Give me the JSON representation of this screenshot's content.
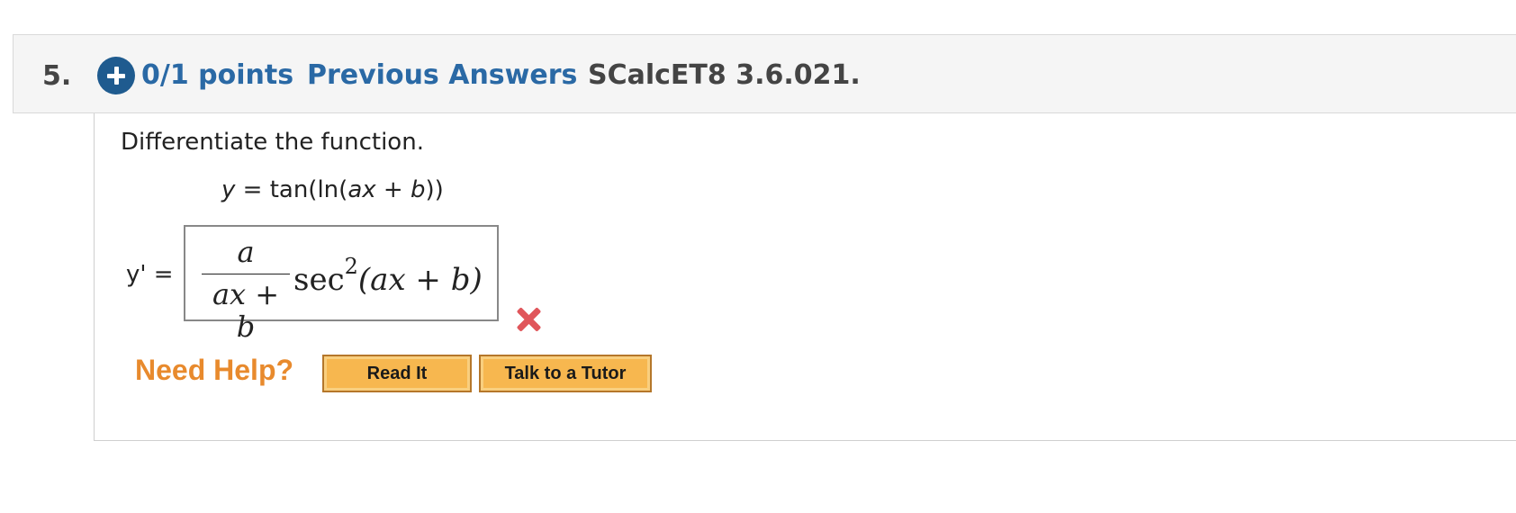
{
  "question": {
    "number": "5.",
    "points": "0/1 points",
    "previous_answers": "Previous Answers",
    "code": "SCalcET8 3.6.021."
  },
  "prompt": "Differentiate the function.",
  "function": {
    "lhs": "y",
    "eq": " = tan(ln(",
    "a": "ax",
    "plus": " + ",
    "b": "b",
    "close": "))"
  },
  "answer": {
    "label": "y' =",
    "numerator": "a",
    "denominator": "ax + b",
    "func": "sec",
    "exponent": "2",
    "argument": "(ax + b)",
    "status": "incorrect"
  },
  "help": {
    "label": "Need Help?",
    "read_it": "Read It",
    "tutor": "Talk to a Tutor"
  },
  "colors": {
    "link": "#2a69a5",
    "plus_icon": "#1f5b8f",
    "need_help": "#e88a2d",
    "button": "#f7b74f",
    "wrong": "#e0565b"
  }
}
